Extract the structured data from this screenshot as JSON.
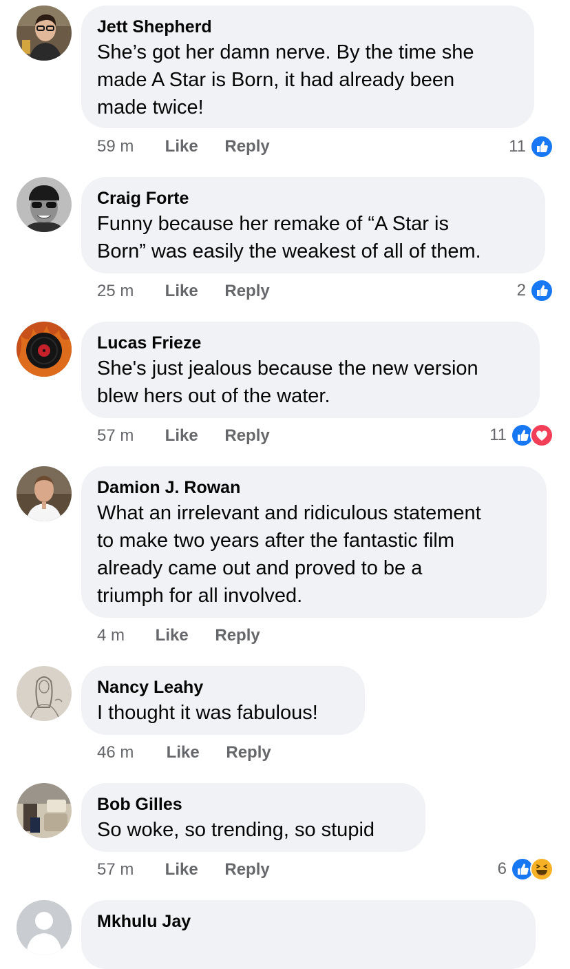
{
  "comments": [
    {
      "author": "Jett Shepherd",
      "lines": [
        "She’s got her damn nerve. By the time she",
        "made A Star is Born, it had already been",
        "made twice!"
      ],
      "time": "59 m",
      "like": "Like",
      "reply": "Reply",
      "reaction_count": "11",
      "reactions": [
        "like-icon"
      ]
    },
    {
      "author": "Craig Forte",
      "lines": [
        "Funny because her remake of “A Star is",
        "Born” was easily the weakest of all of them."
      ],
      "time": "25 m",
      "like": "Like",
      "reply": "Reply",
      "reaction_count": "2",
      "reactions": [
        "like-icon"
      ]
    },
    {
      "author": "Lucas Frieze",
      "lines": [
        "She's just jealous because the new version",
        "blew hers out of the water."
      ],
      "time": "57 m",
      "like": "Like",
      "reply": "Reply",
      "reaction_count": "11",
      "reactions": [
        "like-icon",
        "love-icon"
      ]
    },
    {
      "author": "Damion J. Rowan",
      "lines": [
        "What an irrelevant and ridiculous statement",
        "to make two years after the fantastic film",
        "already came out and proved to be a",
        "triumph for all involved."
      ],
      "time": "4 m",
      "like": "Like",
      "reply": "Reply",
      "reaction_count": "",
      "reactions": []
    },
    {
      "author": "Nancy Leahy",
      "lines": [
        "I thought it was fabulous!"
      ],
      "time": "46 m",
      "like": "Like",
      "reply": "Reply",
      "reaction_count": "",
      "reactions": []
    },
    {
      "author": "Bob Gilles",
      "lines": [
        "So woke, so trending, so stupid"
      ],
      "time": "57 m",
      "like": "Like",
      "reply": "Reply",
      "reaction_count": "6",
      "reactions": [
        "like-icon",
        "haha-icon"
      ]
    },
    {
      "author": "Mkhulu Jay",
      "lines": [],
      "time": "",
      "like": "",
      "reply": "",
      "reaction_count": "",
      "reactions": []
    }
  ],
  "colors": {
    "bubble": "#f0f2f5",
    "meta_text": "#65676b",
    "like_blue": "#1877f2",
    "love_red": "#f33e58",
    "haha_yellow": "#f7b125"
  }
}
